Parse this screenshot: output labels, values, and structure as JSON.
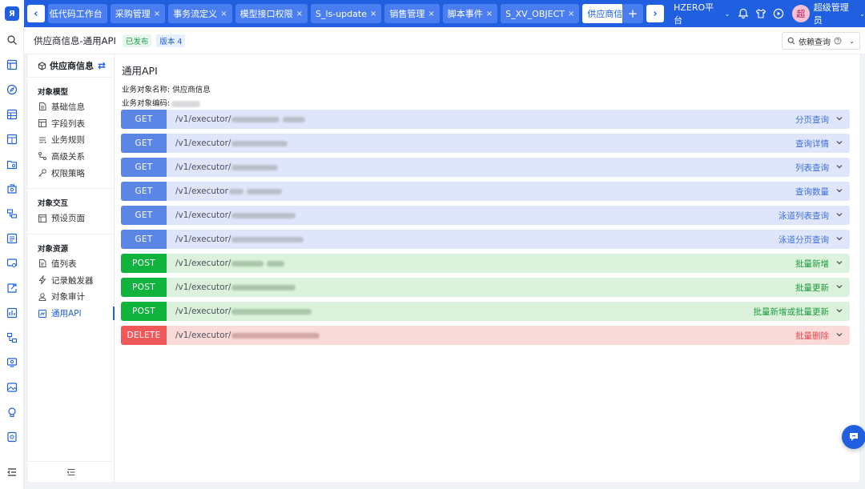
{
  "topbar": {
    "tabs": [
      {
        "label": "低代码工作台",
        "closable": false,
        "active": false
      },
      {
        "label": "采购管理",
        "closable": true,
        "active": false
      },
      {
        "label": "事务流定义",
        "closable": true,
        "active": false
      },
      {
        "label": "模型接口权限",
        "closable": true,
        "active": false
      },
      {
        "label": "S_ls-update",
        "closable": true,
        "active": false
      },
      {
        "label": "销售管理",
        "closable": true,
        "active": false
      },
      {
        "label": "脚本事件",
        "closable": true,
        "active": false
      },
      {
        "label": "S_XV_OBJECT",
        "closable": true,
        "active": false
      },
      {
        "label": "供应商信息",
        "closable": true,
        "active": true
      }
    ],
    "close_glyph": "×",
    "add_glyph": "+",
    "prev_glyph": "‹",
    "next_glyph": "›",
    "platform": "HZERO平台",
    "caret": "⌄",
    "avatar_text": "超",
    "username": "超级管理员",
    "icons": [
      "bell-icon",
      "shirt-icon",
      "play-icon"
    ]
  },
  "header": {
    "title": "供应商信息-通用API",
    "status": "已发布",
    "version": "版本 4",
    "dep_query": "依赖查询"
  },
  "sidebar": {
    "title": "供应商信息",
    "groups": [
      {
        "title": "对象模型",
        "items": [
          {
            "label": "基础信息",
            "icon": "file-icon"
          },
          {
            "label": "字段列表",
            "icon": "list-icon"
          },
          {
            "label": "业务规则",
            "icon": "rule-icon"
          },
          {
            "label": "高级关系",
            "icon": "relation-icon"
          },
          {
            "label": "权限策略",
            "icon": "key-icon"
          }
        ]
      },
      {
        "title": "对象交互",
        "items": [
          {
            "label": "预设页面",
            "icon": "page-icon"
          }
        ]
      },
      {
        "title": "对象资源",
        "items": [
          {
            "label": "值列表",
            "icon": "value-list-icon"
          },
          {
            "label": "记录触发器",
            "icon": "trigger-icon"
          },
          {
            "label": "对象审计",
            "icon": "audit-icon"
          },
          {
            "label": "通用API",
            "icon": "api-icon",
            "active": true
          }
        ]
      }
    ]
  },
  "main": {
    "title": "通用API",
    "object_name_label": "业务对象名称:",
    "object_name": "供应商信息",
    "object_code_label": "业务对象编码:",
    "apis": [
      {
        "method": "GET",
        "path": "/v1/executor/",
        "summary": "分页查询"
      },
      {
        "method": "GET",
        "path": "/v1/executor/",
        "summary": "查询详情"
      },
      {
        "method": "GET",
        "path": "/v1/executor/",
        "summary": "列表查询"
      },
      {
        "method": "GET",
        "path": "/v1/executor",
        "summary": "查询数量"
      },
      {
        "method": "GET",
        "path": "/v1/executor/",
        "summary": "泳道列表查询"
      },
      {
        "method": "GET",
        "path": "/v1/executor/",
        "summary": "泳道分页查询"
      },
      {
        "method": "POST",
        "path": "/v1/executor/",
        "summary": "批量新增"
      },
      {
        "method": "POST",
        "path": "/v1/executor/",
        "summary": "批量更新"
      },
      {
        "method": "POST",
        "path": "/v1/executor/",
        "summary": "批量新增或批量更新"
      },
      {
        "method": "DELETE",
        "path": "/v1/executor/",
        "summary": "批量删除"
      }
    ]
  },
  "colors": {
    "brand": "#1f5fe0",
    "get": "#5b86e5",
    "post": "#10b43c",
    "delete": "#f0585a"
  }
}
